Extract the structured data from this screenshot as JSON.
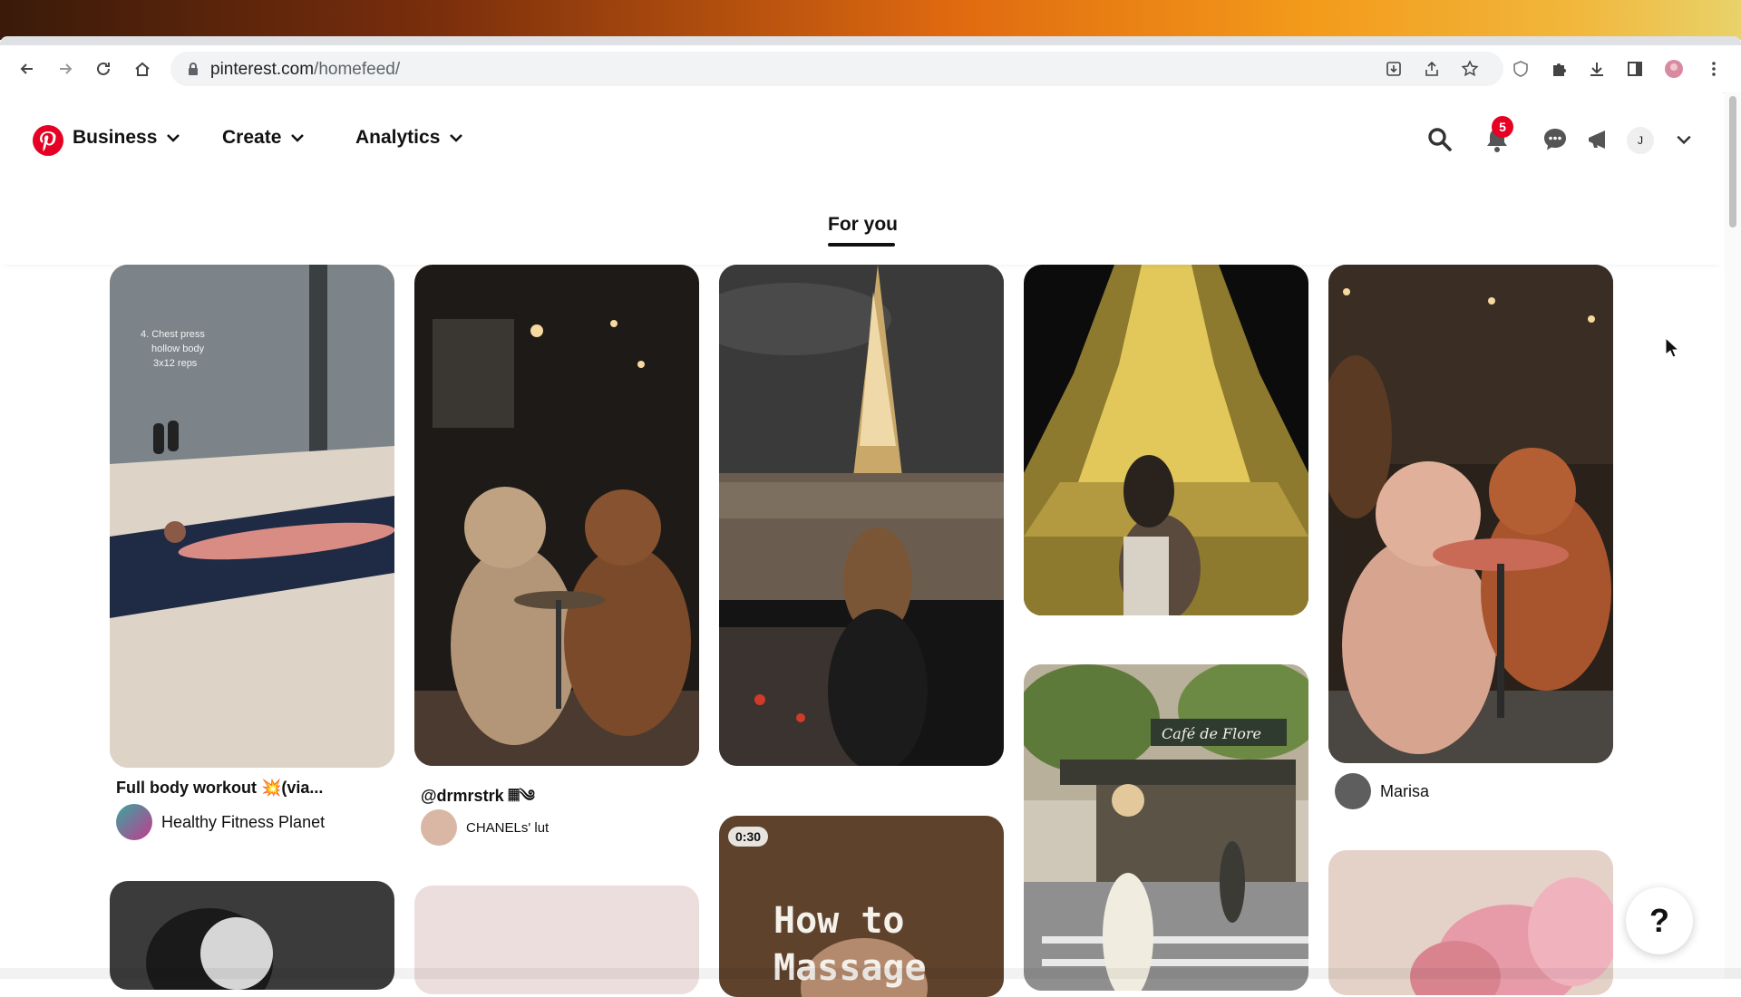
{
  "browser": {
    "url_host": "pinterest.com",
    "url_path": "/homefeed/"
  },
  "header": {
    "nav": [
      {
        "label": "Business"
      },
      {
        "label": "Create"
      },
      {
        "label": "Analytics"
      }
    ],
    "notification_count": "5",
    "avatar_initial": "J",
    "brand_color": "#e60023"
  },
  "tabs": {
    "active": "For you"
  },
  "pins": [
    {
      "title": "Full body workout 💥(via...",
      "author": "Healthy Fitness Planet",
      "image_caption": "4. Chest press\nhollow body\n3x12 reps"
    },
    {
      "title": "@drmrstrk 𝄜༄",
      "author": "CHANELs' lut"
    },
    {
      "title": "",
      "author": ""
    },
    {
      "title": "",
      "author": ""
    },
    {
      "title": "",
      "author": "Marisa"
    },
    {
      "video_duration": "0:30",
      "video_text": "How to\nMassage"
    },
    {
      "sign_text": "Café de Flore"
    }
  ],
  "help": {
    "label": "?"
  }
}
